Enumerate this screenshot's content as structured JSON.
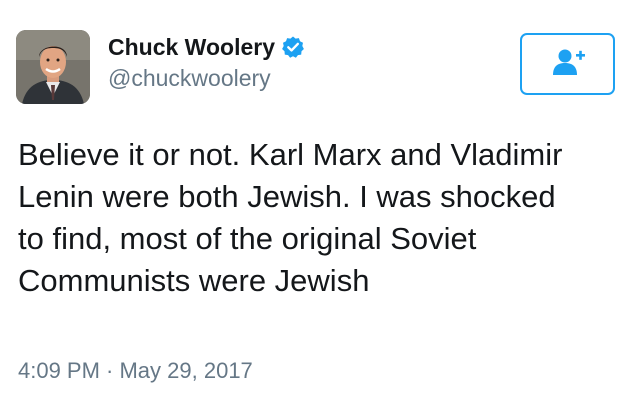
{
  "tweet": {
    "display_name": "Chuck Woolery",
    "handle": "@chuckwoolery",
    "verified": true,
    "text": "Believe it or not. Karl Marx and Vladimir\nLenin were both Jewish. I was shocked\nto find, most of the original  Soviet\nCommunists were Jewish",
    "timestamp": "4:09 PM · May 29, 2017"
  },
  "icons": {
    "verified": "verified-badge-icon",
    "follow": "add-user-icon"
  },
  "colors": {
    "accent": "#1da1f2",
    "text": "#14171a",
    "secondary": "#657786"
  }
}
